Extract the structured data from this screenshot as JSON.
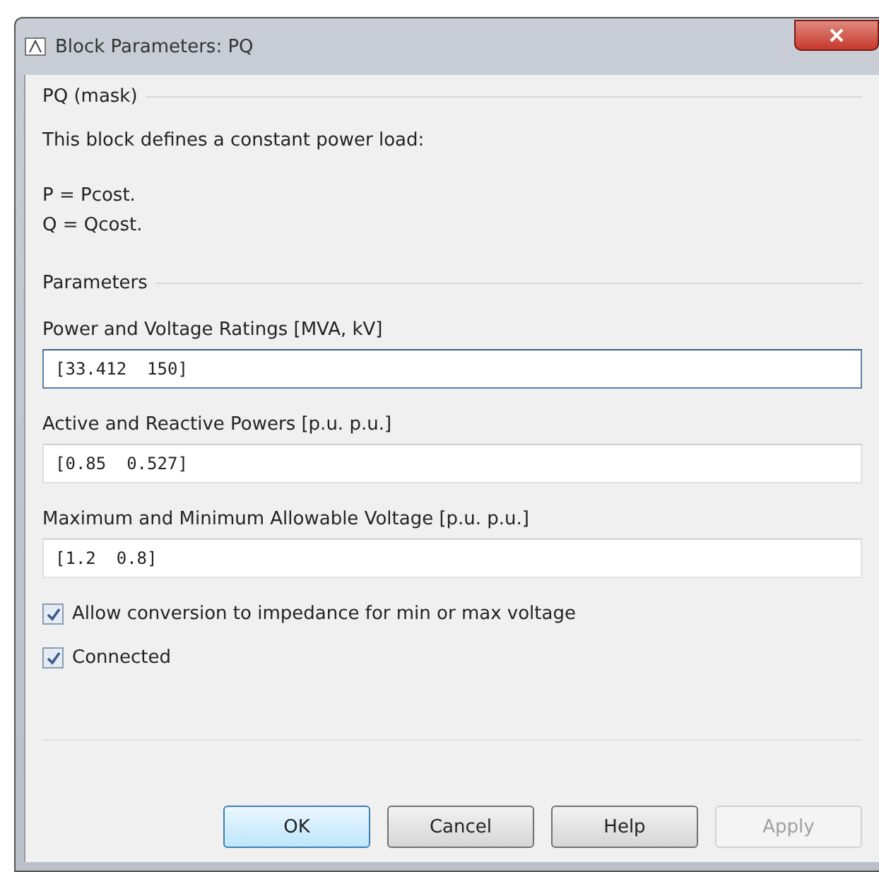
{
  "window": {
    "title": "Block Parameters: PQ"
  },
  "mask_group": {
    "title": "PQ (mask)",
    "description": "This block defines a constant power load:",
    "equations": [
      "P = Pcost.",
      "Q = Qcost."
    ]
  },
  "parameters_group": {
    "title": "Parameters",
    "fields": [
      {
        "label": "Power and Voltage Ratings [MVA, kV]",
        "value": "[33.412  150]",
        "focused": true
      },
      {
        "label": "Active and Reactive Powers [p.u.  p.u.]",
        "value": "[0.85  0.527]",
        "focused": false
      },
      {
        "label": "Maximum and Minimum Allowable Voltage [p.u.  p.u.]",
        "value": "[1.2  0.8]",
        "focused": false
      }
    ],
    "checkboxes": [
      {
        "label": "Allow conversion to impedance for min or max voltage",
        "checked": true
      },
      {
        "label": "Connected",
        "checked": true
      }
    ]
  },
  "buttons": [
    {
      "label": "OK",
      "default": true,
      "disabled": false
    },
    {
      "label": "Cancel",
      "default": false,
      "disabled": false
    },
    {
      "label": "Help",
      "default": false,
      "disabled": false
    },
    {
      "label": "Apply",
      "default": false,
      "disabled": true
    }
  ]
}
